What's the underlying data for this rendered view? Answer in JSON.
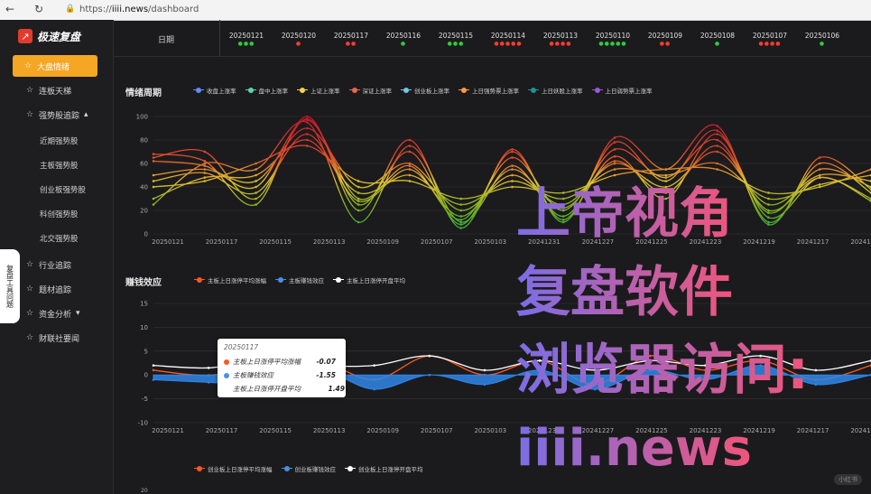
{
  "browser": {
    "url_prefix": "https://",
    "url_host": "iiii.news",
    "url_path": "/dashboard"
  },
  "app": {
    "logo_text": "极速复盘"
  },
  "sidebar": {
    "items": [
      {
        "label": "大盘情绪",
        "icon": "pin-icon",
        "active": true
      },
      {
        "label": "连板天梯",
        "icon": "pin-icon"
      },
      {
        "label": "强势股追踪",
        "icon": "pin-icon",
        "caret": "▴"
      },
      {
        "label": "行业追踪",
        "icon": "pin-icon"
      },
      {
        "label": "题材追踪",
        "icon": "pin-icon"
      },
      {
        "label": "资金分析",
        "icon": "pin-icon",
        "caret": "▾"
      },
      {
        "label": "财联社要闻",
        "icon": "pin-icon"
      }
    ],
    "subitems": [
      "近期强势股",
      "主板强势股",
      "创业板强势股",
      "科创强势股",
      "北交强势股"
    ],
    "side_tab": "复盘工具问题"
  },
  "datebar": {
    "label": "日期",
    "dates": [
      {
        "date": "20250121",
        "dots": "●●●",
        "color": "#2ecc40"
      },
      {
        "date": "20250120",
        "dots": "●",
        "color": "#ff3b30"
      },
      {
        "date": "20250117",
        "dots": "●●",
        "color": "#ff3b30"
      },
      {
        "date": "20250116",
        "dots": "●",
        "color": "#2ecc40"
      },
      {
        "date": "20250115",
        "dots": "●●●",
        "color": "#2ecc40"
      },
      {
        "date": "20250114",
        "dots": "●●●●●",
        "color": "#ff3b30"
      },
      {
        "date": "20250113",
        "dots": "●●●●",
        "color": "#ff3b30"
      },
      {
        "date": "20250110",
        "dots": "●●●●●",
        "color": "#2ecc40"
      },
      {
        "date": "20250109",
        "dots": "●●",
        "color": "#ff3b30"
      },
      {
        "date": "20250108",
        "dots": "●",
        "color": "#2ecc40"
      },
      {
        "date": "20250107",
        "dots": "●●●●",
        "color": "#ff3b30"
      },
      {
        "date": "20250106",
        "dots": "●",
        "color": "#2ecc40"
      }
    ]
  },
  "chart1": {
    "title": "情绪周期",
    "legend": [
      {
        "name": "收盘上涨率",
        "color": "#5b8ff9"
      },
      {
        "name": "盘中上涨率",
        "color": "#5ad8a6"
      },
      {
        "name": "上证上涨率",
        "color": "#f6d04d"
      },
      {
        "name": "深证上涨率",
        "color": "#e8684a"
      },
      {
        "name": "创业板上涨率",
        "color": "#6dc8ec"
      },
      {
        "name": "上日强势票上涨率",
        "color": "#ff9845"
      },
      {
        "name": "上日妖股上涨率",
        "color": "#1e9493"
      },
      {
        "name": "上日弱势票上涨率",
        "color": "#9b59d6"
      }
    ]
  },
  "chart2": {
    "title": "赚钱效应",
    "legend": [
      {
        "name": "主板上日涨停平均涨幅",
        "color": "#ff5722"
      },
      {
        "name": "主板赚钱效应",
        "color": "#4a90e2"
      },
      {
        "name": "主板上日涨停开盘平均",
        "color": "#ffffff"
      }
    ],
    "tooltip": {
      "date": "20250117",
      "rows": [
        {
          "name": "主板上日涨停平均涨幅",
          "value": "-0.07",
          "color": "#ff5722"
        },
        {
          "name": "主板赚钱效应",
          "value": "-1.55",
          "color": "#4a90e2"
        },
        {
          "name": "主板上日涨停开盘平均",
          "value": "1.49",
          "color": "#ffffff"
        }
      ]
    }
  },
  "chart3": {
    "legend": [
      {
        "name": "创业板上日涨停平均涨幅",
        "color": "#ff5722"
      },
      {
        "name": "创业板赚钱效应",
        "color": "#4a90e2"
      },
      {
        "name": "创业板上日涨停开盘平均",
        "color": "#ffffff"
      }
    ],
    "first_tick": "20"
  },
  "overlay": {
    "line1": "上帝视角",
    "line2": "复盘软件",
    "line3": "浏览器访问:",
    "line4": "iiii.news"
  },
  "watermark": "小红书",
  "chart_data": [
    {
      "type": "line",
      "title": "情绪周期",
      "ylim": [
        0,
        100
      ],
      "yticks": [
        0,
        20,
        40,
        60,
        80,
        100
      ],
      "xticks": [
        "20250121",
        "20250117",
        "20250115",
        "20250113",
        "20250109",
        "20250107",
        "20250103",
        "20241231",
        "20241227",
        "20241225",
        "20241223",
        "20241219",
        "20241217",
        "20241213"
      ],
      "series": [
        {
          "name": "收盘上涨率",
          "values": [
            62,
            58,
            40,
            97,
            30,
            58,
            12,
            65,
            20,
            72,
            48,
            80,
            18,
            55,
            40
          ]
        },
        {
          "name": "盘中上涨率",
          "values": [
            25,
            60,
            55,
            95,
            10,
            75,
            10,
            58,
            15,
            66,
            30,
            85,
            14,
            48,
            28
          ]
        },
        {
          "name": "上证上涨率",
          "values": [
            50,
            55,
            45,
            90,
            40,
            60,
            20,
            50,
            25,
            60,
            40,
            70,
            25,
            50,
            45
          ]
        },
        {
          "name": "深证上涨率",
          "values": [
            65,
            70,
            30,
            98,
            25,
            70,
            8,
            70,
            12,
            78,
            45,
            88,
            10,
            60,
            35
          ]
        },
        {
          "name": "创业板上涨率",
          "values": [
            45,
            52,
            35,
            85,
            28,
            55,
            15,
            55,
            22,
            62,
            35,
            75,
            20,
            48,
            30
          ]
        },
        {
          "name": "上日强势票上涨率",
          "values": [
            68,
            62,
            25,
            100,
            20,
            80,
            5,
            72,
            10,
            82,
            55,
            92,
            8,
            65,
            38
          ]
        },
        {
          "name": "上日妖股上涨率",
          "values": [
            30,
            48,
            50,
            80,
            35,
            50,
            25,
            45,
            30,
            55,
            50,
            60,
            30,
            42,
            50
          ]
        },
        {
          "name": "上日弱势票上涨率",
          "values": [
            40,
            45,
            60,
            75,
            45,
            45,
            30,
            40,
            35,
            50,
            55,
            55,
            35,
            40,
            55
          ]
        }
      ]
    },
    {
      "type": "line",
      "title": "赚钱效应",
      "ylim": [
        -10,
        15
      ],
      "yticks": [
        -10,
        -5,
        0,
        5,
        10,
        15
      ],
      "xticks": [
        "20250121",
        "20250117",
        "20250115",
        "20250113",
        "20250109",
        "20250107",
        "20250103",
        "20241231",
        "20241227",
        "20241225",
        "20241223",
        "20241219",
        "20241217",
        "20241213"
      ],
      "series": [
        {
          "name": "主板上日涨停平均涨幅",
          "values": [
            1,
            -0.07,
            2,
            3,
            -1,
            4,
            0,
            3,
            -2,
            4,
            1,
            3,
            -1,
            2
          ]
        },
        {
          "name": "主板赚钱效应",
          "values": [
            -1,
            -1.55,
            -2,
            1,
            -3,
            0,
            -2,
            1,
            -3,
            1,
            -1,
            2,
            -2,
            0
          ]
        },
        {
          "name": "主板上日涨停开盘平均",
          "values": [
            2,
            1.49,
            3,
            2,
            2,
            4,
            1,
            3,
            1,
            3,
            2,
            4,
            1,
            3
          ]
        }
      ]
    }
  ]
}
